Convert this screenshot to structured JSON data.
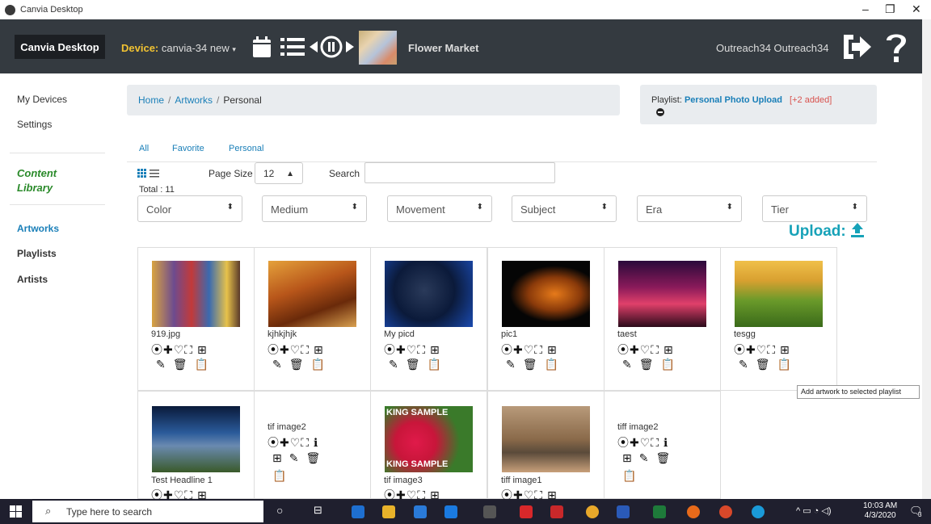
{
  "window": {
    "title": "Canvia Desktop",
    "min": "–",
    "max": "❐",
    "close": "✕"
  },
  "nav": {
    "brand": "Canvia Desktop",
    "device_label": "Device:",
    "device_value": "canvia-34 new",
    "device_caret": "▾",
    "track": "Flower Market",
    "user": "Outreach34 Outreach34"
  },
  "sidebar": {
    "my_devices": "My Devices",
    "settings": "Settings",
    "content_library_1": "Content",
    "content_library_2": "Library",
    "artworks": "Artworks",
    "playlists": "Playlists",
    "artists": "Artists"
  },
  "breadcrumb": {
    "home": "Home",
    "artworks": "Artworks",
    "current": "Personal",
    "sep": "/"
  },
  "playlist": {
    "label": "Playlist:",
    "name": "Personal Photo Upload",
    "added": "[+2 added]"
  },
  "filter_tabs": [
    "All",
    "Favorite",
    "Personal"
  ],
  "list": {
    "total": "Total : 11",
    "page_size_label": "Page Size",
    "page_size_value": "12",
    "search_label": "Search",
    "search_value": ""
  },
  "filters": [
    "Color",
    "Medium",
    "Movement",
    "Subject",
    "Era",
    "Tier"
  ],
  "upload_label": "Upload:",
  "icons": {
    "row_full": "⦿✚♡⛶ ⊞",
    "row_info": "⦿✚♡⛶ ℹ",
    "edit_trash_clip": "✎🗑📋",
    "add_edit_trash": "⊞✎🗑",
    "clip": "📋"
  },
  "artworks": [
    {
      "caption": "919.jpg",
      "color_a": "#6d4b8f",
      "color_b": "#d9a441"
    },
    {
      "caption": "kjhkjhjk",
      "color_a": "#8a3b12",
      "color_b": "#e5a13b"
    },
    {
      "caption": "My picd",
      "color_a": "#0b1a3a",
      "color_b": "#2a5fb8"
    },
    {
      "caption": "pic1",
      "color_a": "#050505",
      "color_b": "#d86a12"
    },
    {
      "caption": "taest",
      "color_a": "#3a0a2a",
      "color_b": "#e0406a"
    },
    {
      "caption": "tesgg",
      "color_a": "#e8b23a",
      "color_b": "#5a8a2a"
    },
    {
      "caption": "Test Headline 1",
      "color_a": "#0a2a5a",
      "color_b": "#3a7ab8"
    },
    {
      "caption": "tif image2",
      "color_a": "",
      "color_b": ""
    },
    {
      "caption": "tif image3",
      "color_a": "#c8163a",
      "color_b": "#3a7a2a",
      "sample": "KING SAMPLE"
    },
    {
      "caption": "tiff image1",
      "color_a": "#8a6a4a",
      "color_b": "#c8a07a"
    },
    {
      "caption": "tiff image2",
      "color_a": "",
      "color_b": ""
    }
  ],
  "tooltip": "Add artwork to selected playlist",
  "taskbar": {
    "search_placeholder": "Type here to search",
    "time": "10:03 AM",
    "date": "4/3/2020",
    "notif": "3"
  }
}
